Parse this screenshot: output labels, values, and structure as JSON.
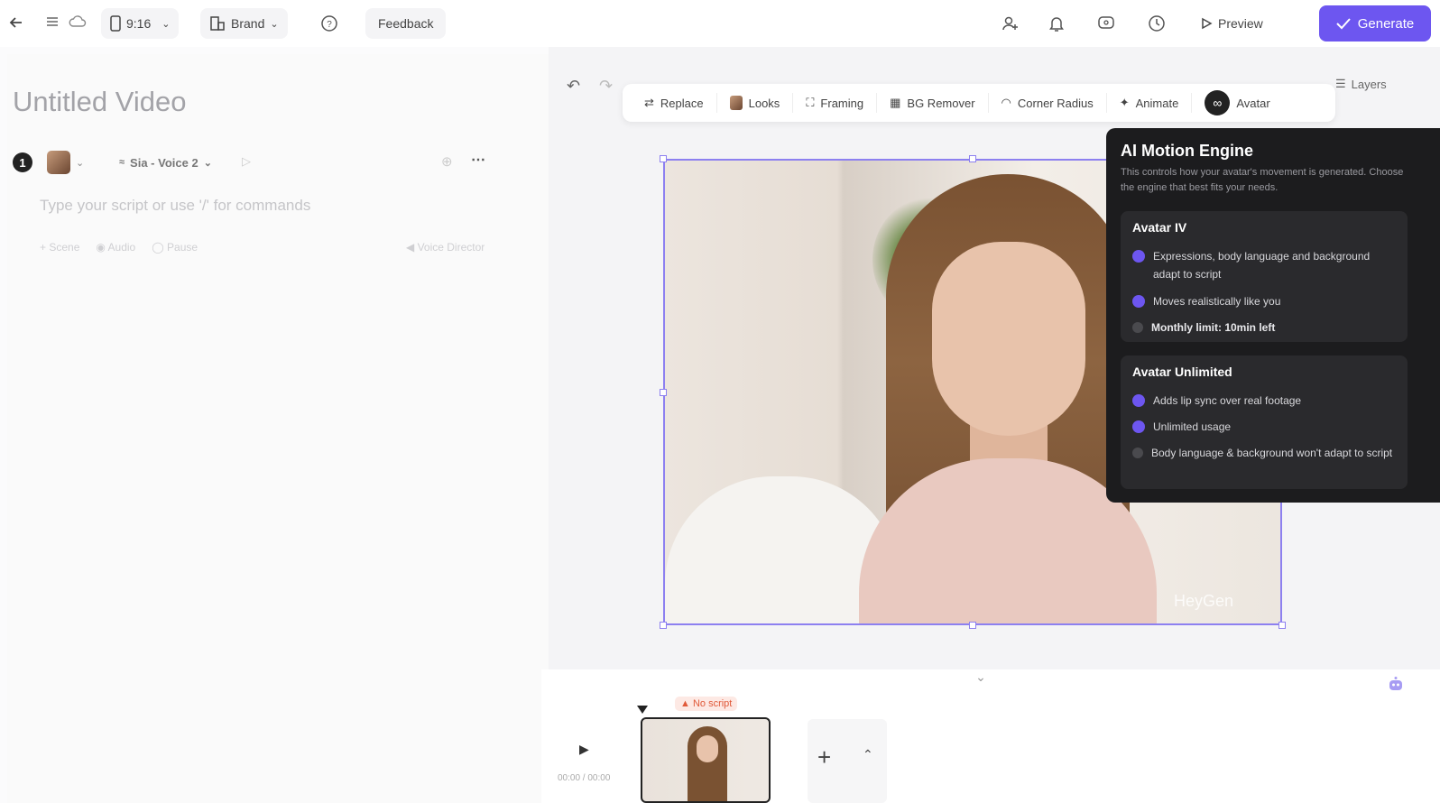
{
  "topbar": {
    "ratio": "9:16",
    "brand": "Brand",
    "feedback": "Feedback",
    "preview": "Preview",
    "generate": "Generate"
  },
  "editor": {
    "title": "Untitled Video",
    "scene_number": "1",
    "voice": "Sia - Voice 2",
    "script_placeholder": "Type your script or use '/' for commands",
    "scene_label": "Scene",
    "audio_label": "Audio",
    "pause_label": "Pause",
    "voice_director": "Voice Director"
  },
  "toolbar": {
    "replace": "Replace",
    "looks": "Looks",
    "framing": "Framing",
    "bg_remover": "BG Remover",
    "corner_radius": "Corner Radius",
    "animate": "Animate",
    "avatar": "Avatar",
    "layers": "Layers"
  },
  "canvas": {
    "watermark": "HeyGen"
  },
  "engine_panel": {
    "title": "AI Motion Engine",
    "description": "This controls how your avatar's movement is generated. Choose the engine that best fits your needs.",
    "cards": [
      {
        "name": "Avatar IV",
        "features": [
          {
            "text": "Expressions, body language and background adapt to script",
            "included": true
          },
          {
            "text": "Moves realistically like you",
            "included": true
          },
          {
            "text": "Monthly limit: 10min left",
            "included": false
          }
        ]
      },
      {
        "name": "Avatar Unlimited",
        "features": [
          {
            "text": "Adds lip sync over real footage",
            "included": true
          },
          {
            "text": "Unlimited usage",
            "included": true
          },
          {
            "text": "Body language & background won't adapt to script",
            "included": false
          }
        ]
      }
    ]
  },
  "timeline": {
    "time": "00:00 / 00:00",
    "no_script": "No script"
  },
  "colors": {
    "accent": "#6d56f0",
    "panel_bg": "#1c1c1e"
  }
}
